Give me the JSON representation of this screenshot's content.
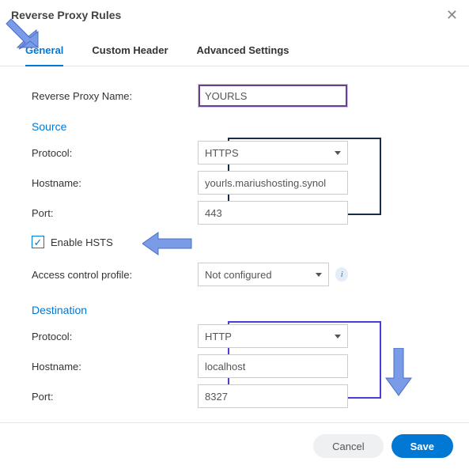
{
  "dialog": {
    "title": "Reverse Proxy Rules"
  },
  "tabs": {
    "general": "General",
    "custom_header": "Custom Header",
    "advanced": "Advanced Settings"
  },
  "fields": {
    "name_label": "Reverse Proxy Name:",
    "name_value": "YOURLS",
    "source_title": "Source",
    "src_protocol_label": "Protocol:",
    "src_protocol_value": "HTTPS",
    "src_hostname_label": "Hostname:",
    "src_hostname_value": "yourls.mariushosting.synol",
    "src_port_label": "Port:",
    "src_port_value": "443",
    "hsts_label": "Enable HSTS",
    "acp_label": "Access control profile:",
    "acp_value": "Not configured",
    "dest_title": "Destination",
    "dst_protocol_label": "Protocol:",
    "dst_protocol_value": "HTTP",
    "dst_hostname_label": "Hostname:",
    "dst_hostname_value": "localhost",
    "dst_port_label": "Port:",
    "dst_port_value": "8327"
  },
  "buttons": {
    "cancel": "Cancel",
    "save": "Save"
  }
}
